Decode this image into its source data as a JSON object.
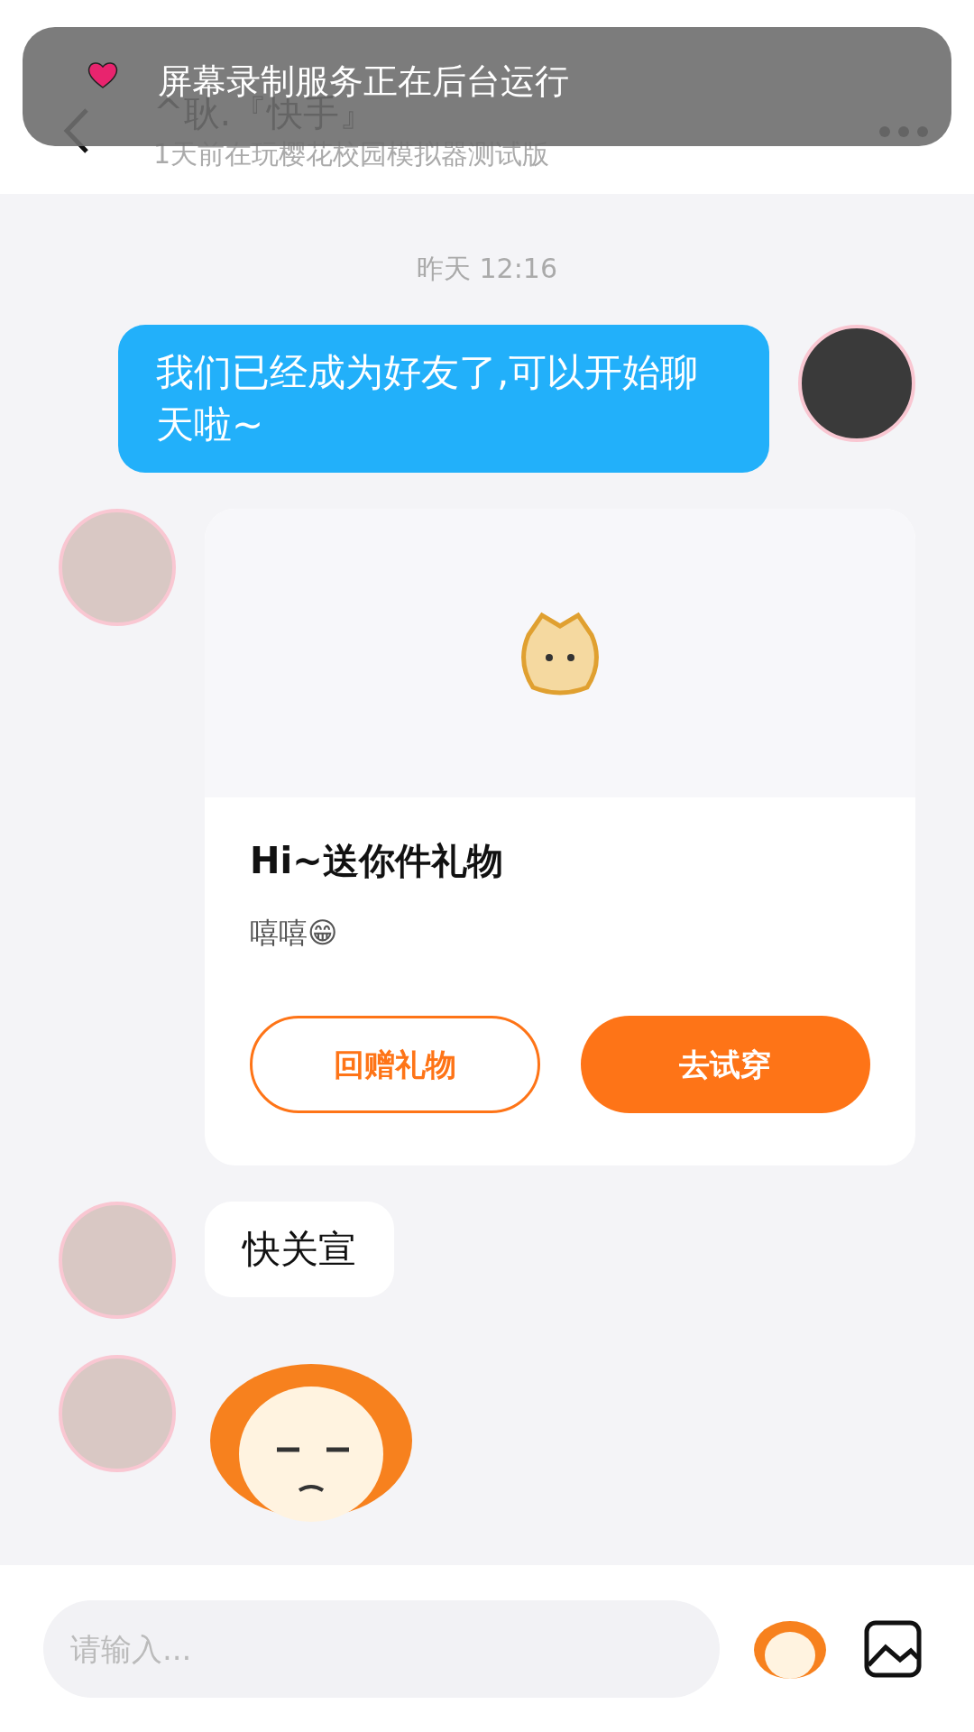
{
  "notification": {
    "text": "屏幕录制服务正在后台运行"
  },
  "header": {
    "title": "^耿.『快手』",
    "subtitle": "1天前在玩樱花校园模拟器测试版"
  },
  "timestamp": "昨天 12:16",
  "messages": [
    {
      "kind": "text",
      "mine": true,
      "text": "我们已经成为好友了,可以开始聊天啦~"
    },
    {
      "kind": "gift",
      "mine": false,
      "title": "Hi~送你件礼物",
      "body": "嘻嘻😁",
      "buttons": [
        {
          "label": "回赠礼物",
          "primary": false
        },
        {
          "label": "去试穿",
          "primary": true
        }
      ]
    },
    {
      "kind": "text",
      "mine": false,
      "text": "快关宣"
    },
    {
      "kind": "sticker",
      "mine": false
    }
  ],
  "input": {
    "placeholder": "请输入..."
  }
}
